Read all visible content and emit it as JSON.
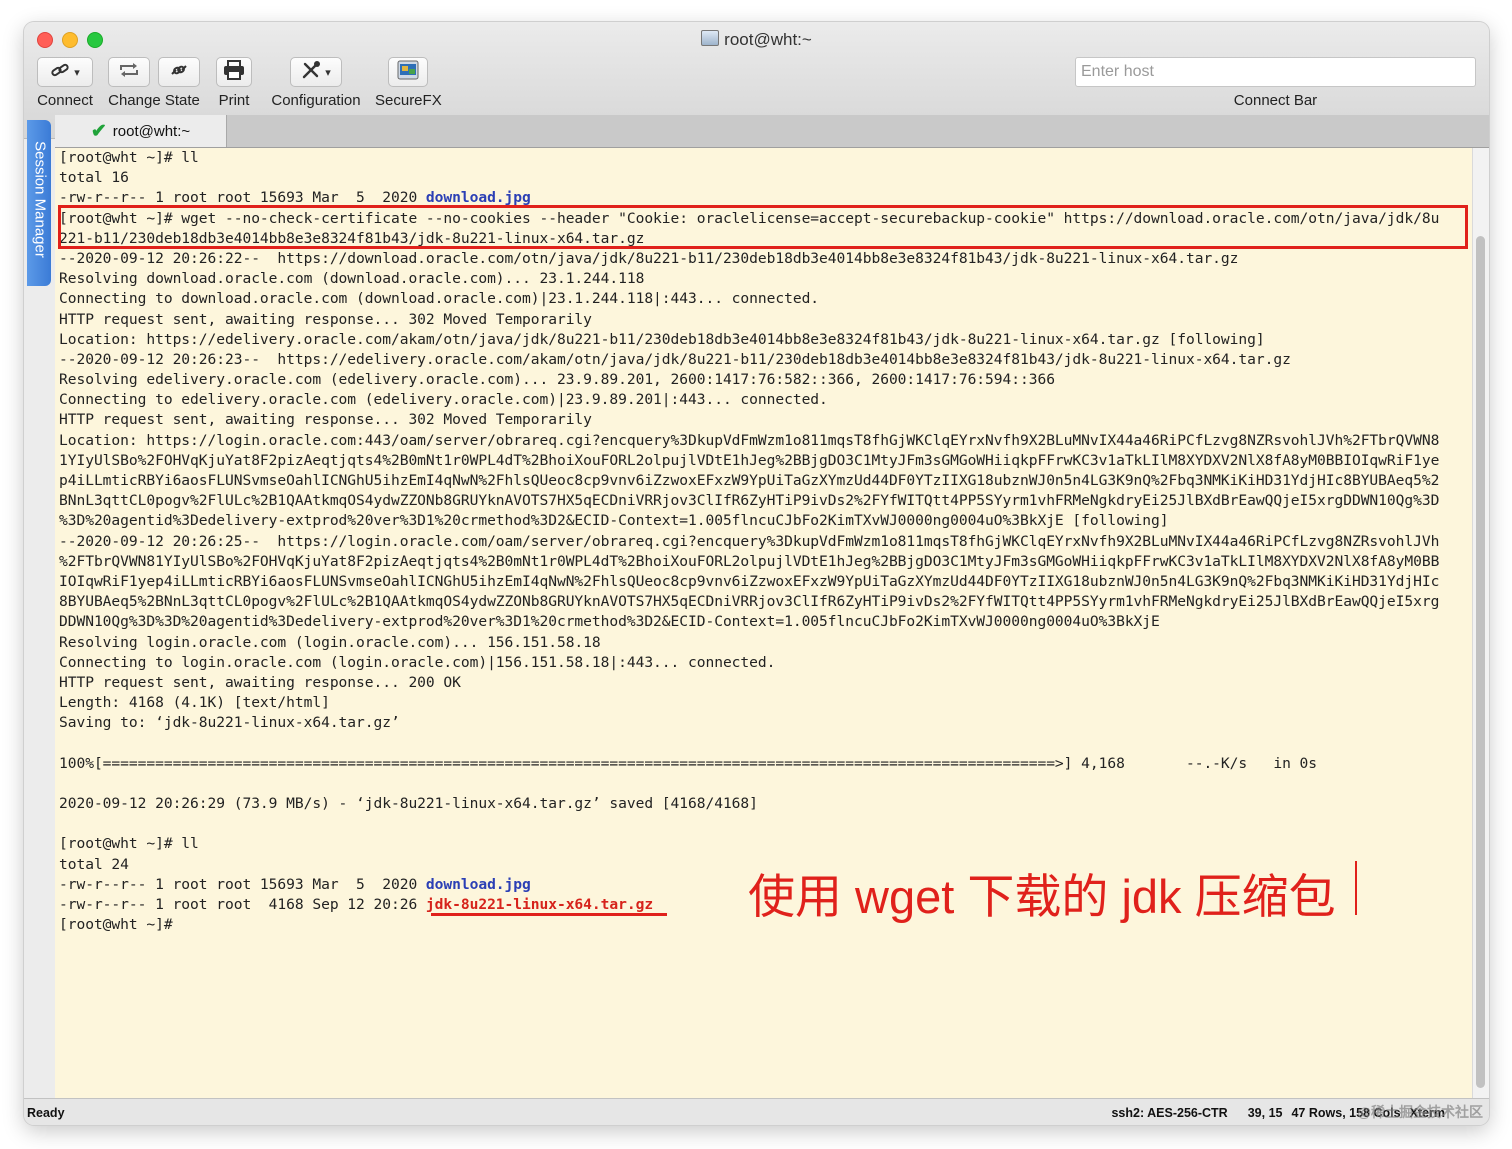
{
  "window": {
    "title": "root@wht:~"
  },
  "toolbar": {
    "items": [
      {
        "label": "Connect",
        "icon": "link-icon"
      },
      {
        "label": "Change State",
        "icon": "reconnect-icon"
      },
      {
        "label": "Print",
        "icon": "printer-icon"
      },
      {
        "label": "Configuration",
        "icon": "tools-icon"
      },
      {
        "label": "SecureFX",
        "icon": "securefx-icon"
      }
    ],
    "host_placeholder": "Enter host",
    "connect_bar_label": "Connect Bar"
  },
  "session_manager": {
    "label": "Session Manager"
  },
  "tabs": [
    {
      "label": "root@wht:~",
      "status": "connected"
    }
  ],
  "terminal": {
    "lines": [
      "[root@wht ~]# ll",
      "total 16",
      "-rw-r--r-- 1 root root 15693 Mar  5  2020 ",
      "[root@wht ~]# wget --no-check-certificate --no-cookies --header \"Cookie: oraclelicense=accept-securebackup-cookie\" https://download.oracle.com/otn/java/jdk/8u",
      "221-b11/230deb18db3e4014bb8e3e8324f81b43/jdk-8u221-linux-x64.tar.gz",
      "--2020-09-12 20:26:22--  https://download.oracle.com/otn/java/jdk/8u221-b11/230deb18db3e4014bb8e3e8324f81b43/jdk-8u221-linux-x64.tar.gz",
      "Resolving download.oracle.com (download.oracle.com)... 23.1.244.118",
      "Connecting to download.oracle.com (download.oracle.com)|23.1.244.118|:443... connected.",
      "HTTP request sent, awaiting response... 302 Moved Temporarily",
      "Location: https://edelivery.oracle.com/akam/otn/java/jdk/8u221-b11/230deb18db3e4014bb8e3e8324f81b43/jdk-8u221-linux-x64.tar.gz [following]",
      "--2020-09-12 20:26:23--  https://edelivery.oracle.com/akam/otn/java/jdk/8u221-b11/230deb18db3e4014bb8e3e8324f81b43/jdk-8u221-linux-x64.tar.gz",
      "Resolving edelivery.oracle.com (edelivery.oracle.com)... 23.9.89.201, 2600:1417:76:582::366, 2600:1417:76:594::366",
      "Connecting to edelivery.oracle.com (edelivery.oracle.com)|23.9.89.201|:443... connected.",
      "HTTP request sent, awaiting response... 302 Moved Temporarily",
      "Location: https://login.oracle.com:443/oam/server/obrareq.cgi?encquery%3DkupVdFmWzm1o811mqsT8fhGjWKClqEYrxNvfh9X2BLuMNvIX44a46RiPCfLzvg8NZRsvohlJVh%2FTbrQVWN8",
      "1YIyUlSBo%2FOHVqKjuYat8F2pizAeqtjqts4%2B0mNt1r0WPL4dT%2BhoiXouFORL2olpujlVDtE1hJeg%2BBjgDO3C1MtyJFm3sGMGoWHiiqkpFFrwKC3v1aTkLIlM8XYDXV2NlX8fA8yM0BBIOIqwRiF1ye",
      "p4iLLmticRBYi6aosFLUNSvmseOahlICNGhU5ihzEmI4qNwN%2FhlsQUeoc8cp9vnv6iZzwoxEFxzW9YpUiTaGzXYmzUd44DF0YTzIIXG18ubznWJ0n5n4LG3K9nQ%2Fbq3NMKiKiHD31YdjHIc8BYUBAeq5%2",
      "BNnL3qttCL0pogv%2FlULc%2B1QAAtkmqOS4ydwZZONb8GRUYknAVOTS7HX5qECDniVRRjov3ClIfR6ZyHTiP9ivDs2%2FYfWITQtt4PP5SYyrm1vhFRMeNgkdryEi25JlBXdBrEawQQjeI5xrgDDWN10Qg%3D",
      "%3D%20agentid%3Dedelivery-extprod%20ver%3D1%20crmethod%3D2&ECID-Context=1.005flncuCJbFo2KimTXvWJ0000ng0004uO%3BkXjE [following]",
      "--2020-09-12 20:26:25--  https://login.oracle.com/oam/server/obrareq.cgi?encquery%3DkupVdFmWzm1o811mqsT8fhGjWKClqEYrxNvfh9X2BLuMNvIX44a46RiPCfLzvg8NZRsvohlJVh",
      "%2FTbrQVWN81YIyUlSBo%2FOHVqKjuYat8F2pizAeqtjqts4%2B0mNt1r0WPL4dT%2BhoiXouFORL2olpujlVDtE1hJeg%2BBjgDO3C1MtyJFm3sGMGoWHiiqkpFFrwKC3v1aTkLIlM8XYDXV2NlX8fA8yM0BB",
      "IOIqwRiF1yep4iLLmticRBYi6aosFLUNSvmseOahlICNGhU5ihzEmI4qNwN%2FhlsQUeoc8cp9vnv6iZzwoxEFxzW9YpUiTaGzXYmzUd44DF0YTzIIXG18ubznWJ0n5n4LG3K9nQ%2Fbq3NMKiKiHD31YdjHIc",
      "8BYUBAeq5%2BNnL3qttCL0pogv%2FlULc%2B1QAAtkmqOS4ydwZZONb8GRUYknAVOTS7HX5qECDniVRRjov3ClIfR6ZyHTiP9ivDs2%2FYfWITQtt4PP5SYyrm1vhFRMeNgkdryEi25JlBXdBrEawQQjeI5xrg",
      "DDWN10Qg%3D%3D%20agentid%3Dedelivery-extprod%20ver%3D1%20crmethod%3D2&ECID-Context=1.005flncuCJbFo2KimTXvWJ0000ng0004uO%3BkXjE",
      "Resolving login.oracle.com (login.oracle.com)... 156.151.58.18",
      "Connecting to login.oracle.com (login.oracle.com)|156.151.58.18|:443... connected.",
      "HTTP request sent, awaiting response... 200 OK",
      "Length: 4168 (4.1K) [text/html]",
      "Saving to: ‘jdk-8u221-linux-x64.tar.gz’",
      "",
      "100%[=============================================================================================================>] 4,168       --.-K/s   in 0s",
      "",
      "2020-09-12 20:26:29 (73.9 MB/s) - ‘jdk-8u221-linux-x64.tar.gz’ saved [4168/4168]",
      "",
      "[root@wht ~]# ll",
      "total 24",
      "-rw-r--r-- 1 root root 15693 Mar  5  2020 ",
      "-rw-r--r-- 1 root root  4168 Sep 12 20:26 ",
      "[root@wht ~]# "
    ],
    "file_download_jpg": "download.jpg",
    "file_jdk": "jdk-8u221-linux-x64.tar.gz"
  },
  "annotation": {
    "text": "使用 wget  下载的 jdk 压缩包"
  },
  "status_bar": {
    "ready": "Ready",
    "cipher": "ssh2: AES-256-CTR",
    "cursor": "39, 15",
    "rows": "47 Rows, 158 Cols",
    "term": "Xterm"
  },
  "watermark": {
    "text": "@稀土掘金技术社区"
  },
  "colors": {
    "terminal_bg": "#fdf6dc",
    "highlight_red": "#e0211b",
    "link_blue": "#2b3fb5",
    "session_tab_blue": "#3b7bd6"
  }
}
